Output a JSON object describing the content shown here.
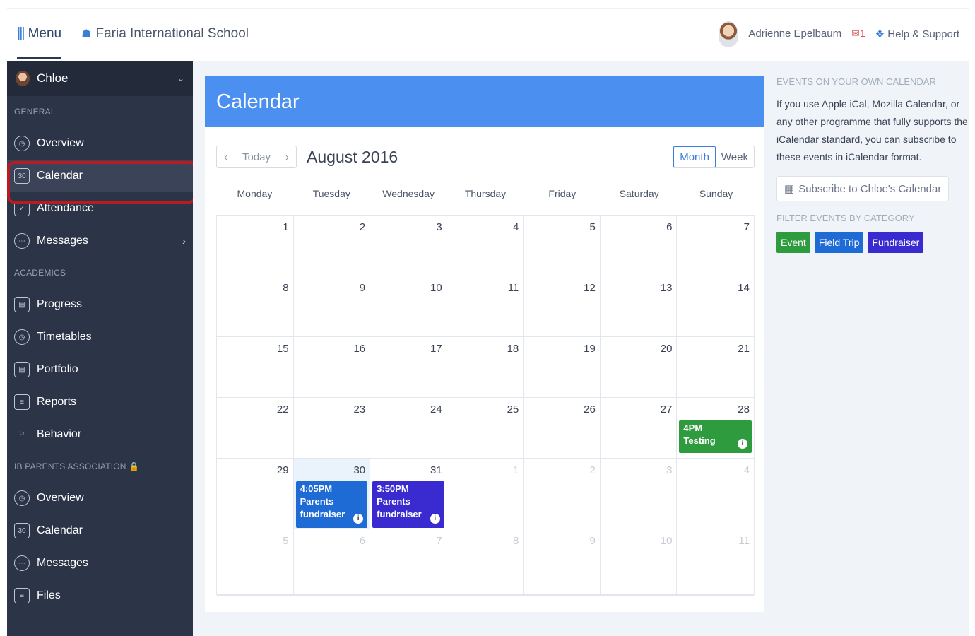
{
  "topbar": {
    "menu_label": "Menu",
    "school_name": "Faria International School",
    "user_name": "Adrienne Epelbaum",
    "mail_count": "1",
    "help_label": "Help & Support"
  },
  "sidebar": {
    "user": "Chloe",
    "general_title": "GENERAL",
    "general_items": [
      {
        "label": "Overview"
      },
      {
        "label": "Calendar"
      },
      {
        "label": "Attendance"
      },
      {
        "label": "Messages"
      }
    ],
    "academics_title": "ACADEMICS",
    "academics_items": [
      {
        "label": "Progress"
      },
      {
        "label": "Timetables"
      },
      {
        "label": "Portfolio"
      },
      {
        "label": "Reports"
      },
      {
        "label": "Behavior"
      }
    ],
    "parents_title": "IB PARENTS ASSOCIATION",
    "parents_items": [
      {
        "label": "Overview"
      },
      {
        "label": "Calendar"
      },
      {
        "label": "Messages"
      },
      {
        "label": "Files"
      }
    ]
  },
  "calendar": {
    "heading": "Calendar",
    "today_label": "Today",
    "month_title": "August 2016",
    "view_month": "Month",
    "view_week": "Week",
    "weekdays": [
      "Monday",
      "Tuesday",
      "Wednesday",
      "Thursday",
      "Friday",
      "Saturday",
      "Sunday"
    ],
    "days": [
      "1",
      "2",
      "3",
      "4",
      "5",
      "6",
      "7",
      "8",
      "9",
      "10",
      "11",
      "12",
      "13",
      "14",
      "15",
      "16",
      "17",
      "18",
      "19",
      "20",
      "21",
      "22",
      "23",
      "24",
      "25",
      "26",
      "27",
      "28",
      "29",
      "30",
      "31",
      "1",
      "2",
      "3",
      "4",
      "5",
      "6",
      "7",
      "8",
      "9",
      "10",
      "11"
    ],
    "events": {
      "sun28": {
        "time": "4PM",
        "title": "Testing"
      },
      "tue30": {
        "time": "4:05PM",
        "title": "Parents fundraiser"
      },
      "wed31": {
        "time": "3:50PM",
        "title": "Parents fundraiser"
      }
    }
  },
  "right": {
    "own_title": "EVENTS ON YOUR OWN CALENDAR",
    "own_text": "If you use Apple iCal, Mozilla Calendar, or any other programme that fully supports the iCalendar standard, you can subscribe to these events in iCalendar format.",
    "subscribe_label": "Subscribe to Chloe's Calendar",
    "filter_title": "FILTER EVENTS BY CATEGORY",
    "categories": [
      {
        "label": "Event",
        "color": "#2e9c3e"
      },
      {
        "label": "Field Trip",
        "color": "#1e6bd6"
      },
      {
        "label": "Fundraiser",
        "color": "#3a2bd0"
      }
    ]
  },
  "colors": {
    "header_blue": "#4b8ff0",
    "sidebar_bg": "#2c3447",
    "highlight_red": "#b81c22"
  }
}
